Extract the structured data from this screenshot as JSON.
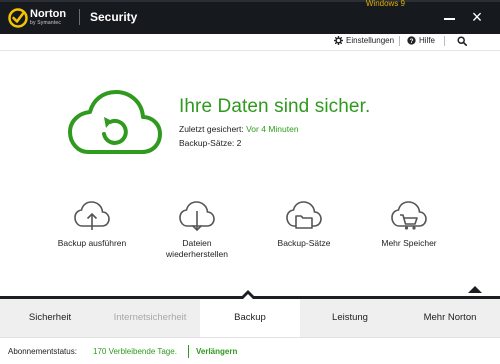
{
  "window": {
    "caption_fragment": "Windows 9",
    "brand": "Norton",
    "brand_sub": "by Symantec",
    "title": "Security"
  },
  "toolbar": {
    "settings_label": "Einstellungen",
    "help_label": "Hilfe"
  },
  "status": {
    "headline": "Ihre Daten sind sicher.",
    "last_backup_label": "Zuletzt gesichert:",
    "last_backup_value": "Vor 4 Minuten",
    "backup_sets_label": "Backup-Sätze:",
    "backup_sets_value": "2"
  },
  "actions": [
    {
      "label": "Backup ausführen",
      "icon": "cloud-upload-icon"
    },
    {
      "label": "Dateien wiederherstellen",
      "icon": "cloud-download-icon"
    },
    {
      "label": "Backup-Sätze",
      "icon": "cloud-folder-icon"
    },
    {
      "label": "Mehr Speicher",
      "icon": "cloud-cart-icon"
    }
  ],
  "tabs": [
    {
      "label": "Sicherheit",
      "state": "normal"
    },
    {
      "label": "Internetsicherheit",
      "state": "disabled"
    },
    {
      "label": "Backup",
      "state": "active"
    },
    {
      "label": "Leistung",
      "state": "normal"
    },
    {
      "label": "Mehr Norton",
      "state": "normal"
    }
  ],
  "statusbar": {
    "subscription_label": "Abonnementstatus:",
    "days_remaining": "170 Verbleibende Tage.",
    "renew_label": "Verlängern"
  },
  "colors": {
    "accent_green": "#2f9a1e",
    "titlebar": "#16191e",
    "logo_yellow": "#f5c400"
  }
}
